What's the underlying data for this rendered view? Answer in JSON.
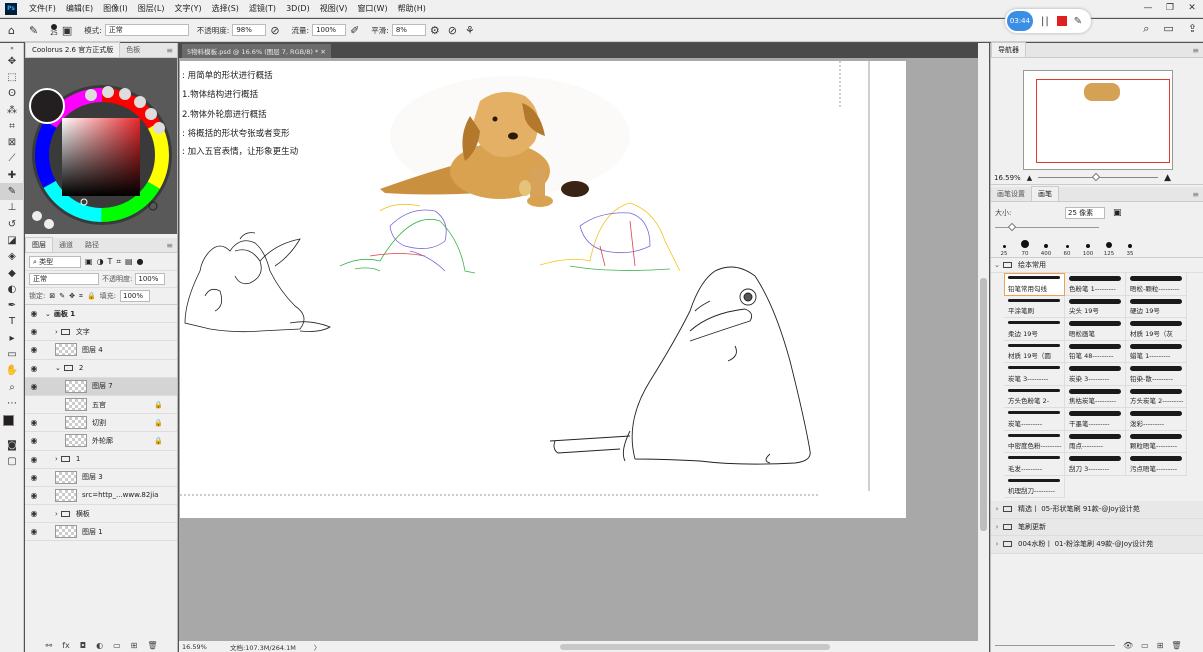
{
  "menu": {
    "items": [
      "文件(F)",
      "编辑(E)",
      "图像(I)",
      "图层(L)",
      "文字(Y)",
      "选择(S)",
      "滤镜(T)",
      "3D(D)",
      "视图(V)",
      "窗口(W)",
      "帮助(H)"
    ]
  },
  "options": {
    "brush_size": "25",
    "mode_label": "模式:",
    "mode_value": "正常",
    "opacity_label": "不透明度:",
    "opacity_value": "98%",
    "flow_label": "流量:",
    "flow_value": "100%",
    "smooth_label": "平滑:",
    "smooth_value": "8%"
  },
  "recorder": {
    "time": "03:44"
  },
  "document": {
    "tab_title": "5物料模板.psd @ 16.6% (图层 7, RGB/8) *",
    "notes": [
      ": 用简单的形状进行概括",
      "1.物体结构进行概括",
      "2.物体外轮廓进行概括",
      ": 将概括的形状夸张或者变形",
      ": 加入五官表情，让形象更生动"
    ]
  },
  "status": {
    "zoom": "16.59%",
    "doc_size": "文档:107.3M/264.1M"
  },
  "left": {
    "color_tabs": [
      "Coolorus 2.6 官方正式版",
      "色板"
    ],
    "layer_tabs": [
      "图层",
      "通道",
      "路径"
    ],
    "filter_label": "类型",
    "blend_mode": "正常",
    "opacity_label": "不透明度:",
    "opacity_value": "100%",
    "lock_label": "锁定:",
    "fill_label": "填充:",
    "fill_value": "100%",
    "layers": [
      {
        "name": "画板 1",
        "kind": "artboard",
        "indent": 0,
        "eye": true
      },
      {
        "name": "文字",
        "kind": "group",
        "indent": 1,
        "eye": true
      },
      {
        "name": "图层 4",
        "kind": "layer",
        "indent": 1,
        "eye": true
      },
      {
        "name": "2",
        "kind": "group-open",
        "indent": 1,
        "eye": true
      },
      {
        "name": "图层 7",
        "kind": "layer",
        "indent": 2,
        "eye": true,
        "selected": true
      },
      {
        "name": "五官",
        "kind": "layer",
        "indent": 2,
        "eye": false,
        "locked": true
      },
      {
        "name": "切割",
        "kind": "layer",
        "indent": 2,
        "eye": true,
        "locked": true
      },
      {
        "name": "外轮廓",
        "kind": "layer",
        "indent": 2,
        "eye": true,
        "locked": true
      },
      {
        "name": "1",
        "kind": "group",
        "indent": 1,
        "eye": true
      },
      {
        "name": "图层 3",
        "kind": "layer",
        "indent": 1,
        "eye": true
      },
      {
        "name": "src=http_...www.82jia",
        "kind": "layer",
        "indent": 1,
        "eye": true
      },
      {
        "name": "横板",
        "kind": "group",
        "indent": 1,
        "eye": true
      },
      {
        "name": "图层 1",
        "kind": "layer",
        "indent": 1,
        "eye": true
      }
    ]
  },
  "right": {
    "navigator_tab": "导航器",
    "nav_zoom": "16.59%",
    "brush_tabs": [
      "画笔设置",
      "画笔"
    ],
    "size_label": "大小:",
    "size_value": "25 像素",
    "brush_presets": [
      "25",
      "70",
      "400",
      "60",
      "100",
      "125",
      "35"
    ],
    "group_title": "绘本常用",
    "brushes": [
      "铅笔常用勾线",
      "色粉笔 1---------",
      "晤松-颗粒---------",
      "平涂笔刷",
      "尖头 19号",
      "硬边 19号",
      "柔边 19号",
      "晤松画笔",
      "材质 19号（灰",
      "材质 19号（圆",
      "铅笔 48---------",
      "蜡笔 1---------",
      "炭笔 3---------",
      "炭染 3---------",
      "铅染-散---------",
      "方头色粉笔 2-",
      "焦枯炭笔---------",
      "方头炭笔 2---------",
      "炭笔---------",
      "干墨笔---------",
      "泼彩---------",
      "中密度色粉---------",
      "雨点---------",
      "颗粒晤笔---------",
      "毛发---------",
      "刮刀 3---------",
      "污点晤笔---------",
      "机理刮刀---------"
    ],
    "folders": [
      "精选丨 05-形状笔刷 91款-@Joy设计苑",
      "笔刷更新",
      "004水粉丨 01-粉涂笔刷 49款-@Joy设计苑"
    ]
  },
  "colors": {
    "foreground": "#231f20",
    "accent": "#3a8ee6"
  }
}
